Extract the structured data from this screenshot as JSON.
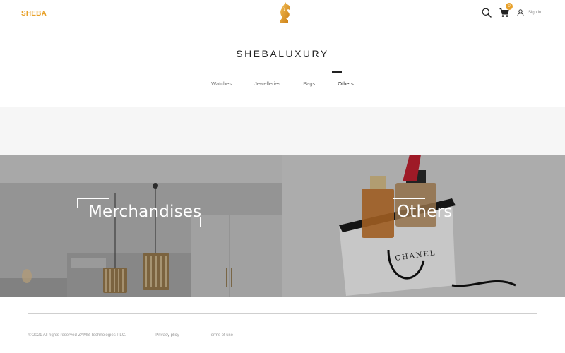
{
  "header": {
    "brand": "SHEBA",
    "logo_icon": "knight-horse-logo-icon",
    "search_icon": "search-icon",
    "cart_icon": "cart-icon",
    "cart_count": "0",
    "user_icon": "user-icon",
    "signin_label": "Sign in"
  },
  "site_title": "SHEBALUXURY",
  "nav": {
    "items": [
      {
        "label": "Watches"
      },
      {
        "label": "Jewelleries"
      },
      {
        "label": "Bags"
      },
      {
        "label": "Others"
      }
    ],
    "active": "Others"
  },
  "categories": [
    {
      "label": "Merchandises"
    },
    {
      "label": "Others"
    }
  ],
  "footer": {
    "copyright": "© 2021 All rights reserved ZAMB Technologies PLC.",
    "separator": "|",
    "privacy": "Privacy plicy",
    "dash": "-",
    "terms": "Terms of use"
  },
  "colors": {
    "accent": "#e8a12a",
    "text": "#222222",
    "muted": "#777777",
    "band": "#f6f6f6"
  }
}
